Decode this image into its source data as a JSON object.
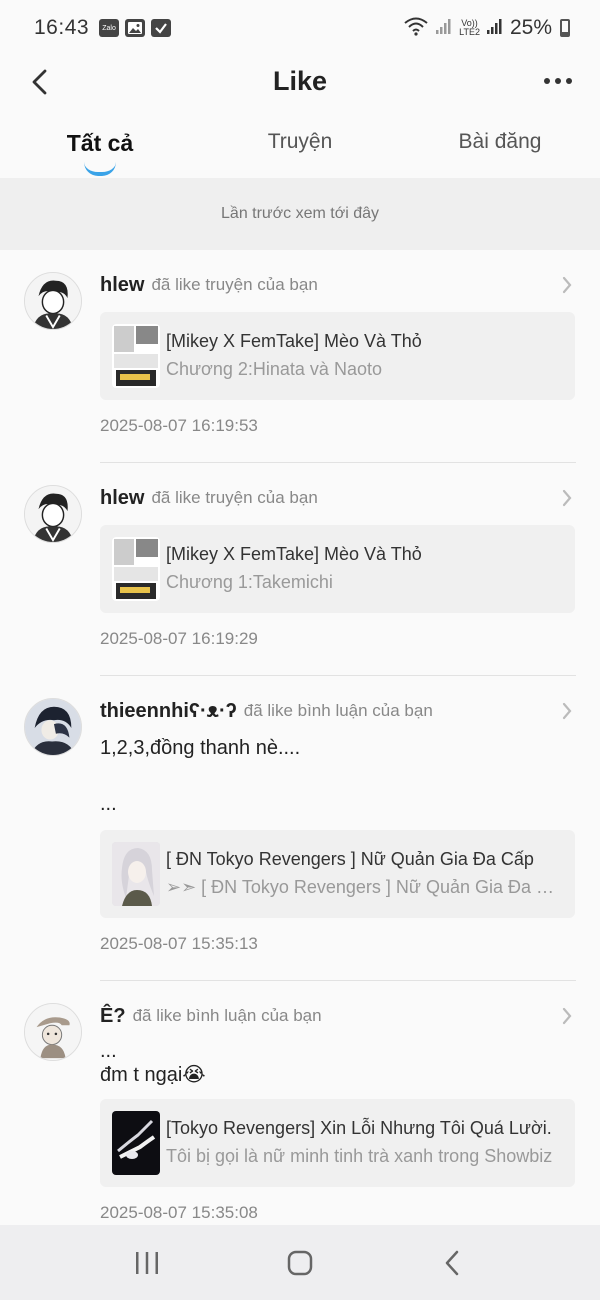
{
  "status_bar": {
    "time": "16:43",
    "notif_icons": [
      "zalo-icon",
      "image-icon",
      "checkbox-icon"
    ],
    "notif_zalo_label": "Zalo",
    "network_label_top": "Vo))",
    "network_label_bottom": "LTE2",
    "battery_percent": "25%"
  },
  "header": {
    "title": "Like"
  },
  "tabs": [
    {
      "label": "Tất cả",
      "active": true
    },
    {
      "label": "Truyện",
      "active": false
    },
    {
      "label": "Bài đăng",
      "active": false
    }
  ],
  "last_seen_text": "Lần trước xem tới đây",
  "feed": [
    {
      "username": "hlew",
      "action": "đã like truyện của bạn",
      "comment": "",
      "card_title": "[Mikey X FemTake] Mèo Và Thỏ",
      "card_sub": "Chương 2:Hinata và Naoto",
      "time": "2025-08-07 16:19:53"
    },
    {
      "username": "hlew",
      "action": "đã like truyện của bạn",
      "comment": "",
      "card_title": "[Mikey X FemTake] Mèo Và Thỏ",
      "card_sub": "Chương 1:Takemichi",
      "time": "2025-08-07 16:19:29"
    },
    {
      "username": "thieennhiʕ·ᴥ·ʔ",
      "action": "đã like bình luận của bạn",
      "comment": "1,2,3,đồng thanh nè....\n\n...",
      "card_title": "[ ĐN Tokyo Revengers ] Nữ Quản Gia Đa Cấp",
      "card_sub": "➢➣ [ ĐN Tokyo Revengers ] Nữ Quản Gia Đa Cấp",
      "time": "2025-08-07 15:35:13"
    },
    {
      "username": "Ê?",
      "action": "đã like bình luận của bạn",
      "comment": "...\nđm t ngại😭",
      "card_title": "[Tokyo Revengers] Xin Lỗi Nhưng Tôi Quá Lười.",
      "card_sub": "Tôi bị gọi là nữ minh tinh trà xanh trong Showbiz",
      "time": "2025-08-07 15:35:08"
    }
  ],
  "nav_bar": {
    "icons": [
      "recent-apps-icon",
      "home-icon",
      "back-nav-icon"
    ]
  },
  "colors": {
    "accent": "#3aa3e8",
    "banner_bg": "#efefef",
    "card_bg": "#f0f0f0"
  }
}
